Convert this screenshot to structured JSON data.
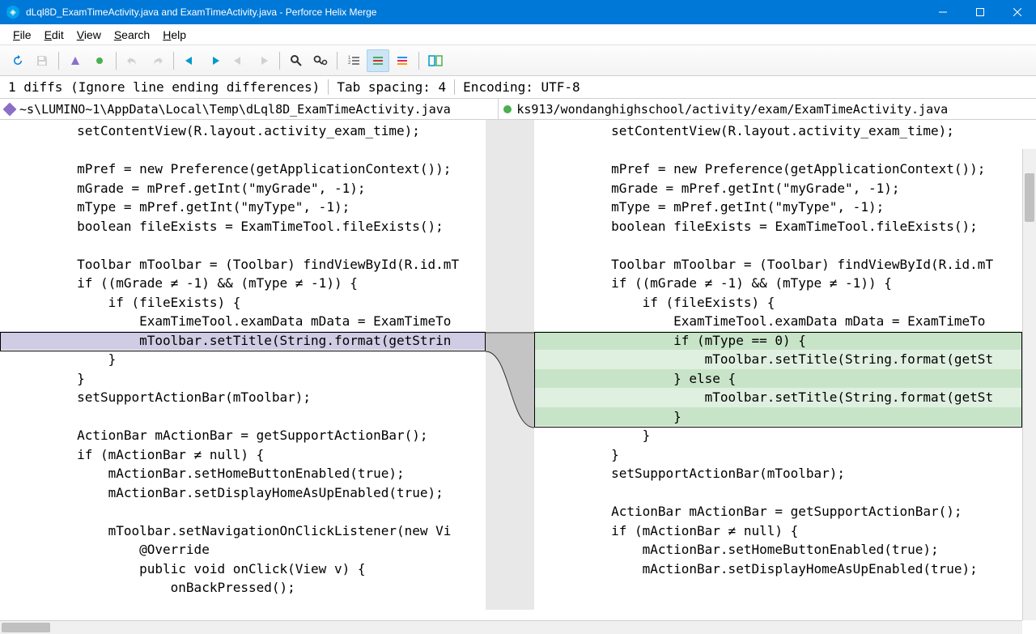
{
  "window": {
    "title": "dLql8D_ExamTimeActivity.java and ExamTimeActivity.java - Perforce Helix Merge"
  },
  "menu": {
    "file": "File",
    "edit": "Edit",
    "view": "View",
    "search": "Search",
    "help": "Help"
  },
  "status": {
    "diffs": "1 diffs (Ignore line ending differences)",
    "tab": "Tab spacing: 4",
    "encoding": "Encoding: UTF-8"
  },
  "tabs": {
    "left": "~s\\LUMINO~1\\AppData\\Local\\Temp\\dLql8D_ExamTimeActivity.java",
    "right": "ks913/wondanghighschool/activity/exam/ExamTimeActivity.java"
  },
  "left_lines": [
    "        setContentView(R.layout.activity_exam_time);",
    "",
    "        mPref = new Preference(getApplicationContext());",
    "        mGrade = mPref.getInt(\"myGrade\", -1);",
    "        mType = mPref.getInt(\"myType\", -1);",
    "        boolean fileExists = ExamTimeTool.fileExists();",
    "",
    "        Toolbar mToolbar = (Toolbar) findViewById(R.id.mT",
    "        if ((mGrade ≠ -1) && (mType ≠ -1)) {",
    "            if (fileExists) {",
    "                ExamTimeTool.examData mData = ExamTimeTo",
    "                mToolbar.setTitle(String.format(getStrin",
    "            }",
    "        }",
    "        setSupportActionBar(mToolbar);",
    "",
    "        ActionBar mActionBar = getSupportActionBar();",
    "        if (mActionBar ≠ null) {",
    "            mActionBar.setHomeButtonEnabled(true);",
    "            mActionBar.setDisplayHomeAsUpEnabled(true);",
    "",
    "            mToolbar.setNavigationOnClickListener(new Vi",
    "                @Override",
    "                public void onClick(View v) {",
    "                    onBackPressed();"
  ],
  "right_lines": [
    "        setContentView(R.layout.activity_exam_time);",
    "",
    "        mPref = new Preference(getApplicationContext());",
    "        mGrade = mPref.getInt(\"myGrade\", -1);",
    "        mType = mPref.getInt(\"myType\", -1);",
    "        boolean fileExists = ExamTimeTool.fileExists();",
    "",
    "        Toolbar mToolbar = (Toolbar) findViewById(R.id.mT",
    "        if ((mGrade ≠ -1) && (mType ≠ -1)) {",
    "            if (fileExists) {",
    "                ExamTimeTool.examData mData = ExamTimeTo",
    "                if (mType == 0) {",
    "                    mToolbar.setTitle(String.format(getSt",
    "                } else {",
    "                    mToolbar.setTitle(String.format(getSt",
    "                }",
    "            }",
    "        }",
    "        setSupportActionBar(mToolbar);",
    "",
    "        ActionBar mActionBar = getSupportActionBar();",
    "        if (mActionBar ≠ null) {",
    "            mActionBar.setHomeButtonEnabled(true);",
    "            mActionBar.setDisplayHomeAsUpEnabled(true);",
    ""
  ]
}
